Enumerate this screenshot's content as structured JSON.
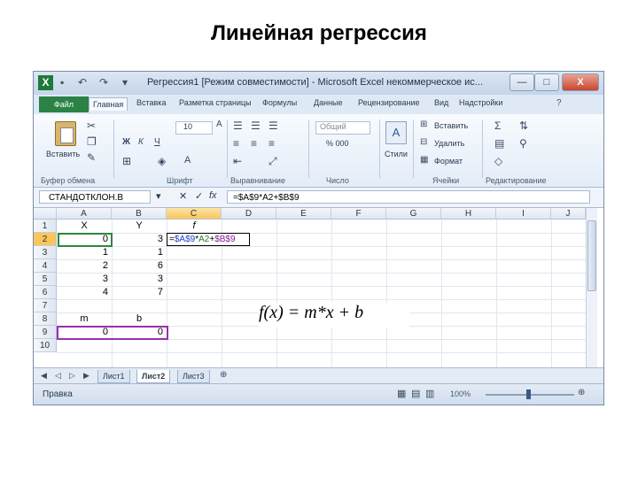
{
  "slide_title": "Линейная регрессия",
  "titlebar": {
    "app_icon": "X",
    "title": "Регрессия1 [Режим совместимости] - Microsoft Excel некоммерческое ис...",
    "min": "—",
    "max": "□",
    "close": "X"
  },
  "tabs": [
    "Файл",
    "Главная",
    "Вставка",
    "Разметка страницы",
    "Формулы",
    "Данные",
    "Рецензирование",
    "Вид",
    "Надстройки"
  ],
  "ribbon": {
    "paste": "Вставить",
    "font_size": "10",
    "bold": "Ж",
    "italic": "К",
    "underline": "Ч",
    "number_format": "Общий",
    "percent": "% 000",
    "styles": "Стили",
    "insert": "Вставить",
    "delete": "Удалить",
    "format": "Формат",
    "groups": [
      "Буфер обмена",
      "Шрифт",
      "Выравнивание",
      "Число",
      "Ячейки",
      "Редактирование"
    ]
  },
  "formula_bar": {
    "namebox": "СТАНДОТКЛОН.В",
    "cancel": "✕",
    "enter": "✓",
    "fx": "fx",
    "formula": "=$A$9*A2+$B$9"
  },
  "columns": [
    "A",
    "B",
    "C",
    "D",
    "E",
    "F",
    "G",
    "H",
    "I",
    "J"
  ],
  "rows": [
    "1",
    "2",
    "3",
    "4",
    "5",
    "6",
    "7",
    "8",
    "9",
    "10"
  ],
  "cells": {
    "A1": "X",
    "B1": "Y",
    "C1": "f",
    "A2": "0",
    "B2": "3",
    "A3": "1",
    "B3": "1",
    "A4": "2",
    "B4": "6",
    "A5": "3",
    "B5": "3",
    "A6": "4",
    "B6": "7",
    "A8": "m",
    "B8": "b",
    "A9": "0",
    "B9": "0"
  },
  "edit_cell": {
    "prefix": "=",
    "ref1": "$A$9",
    "mid1": "*",
    "ref2": "A2",
    "mid2": "+",
    "ref3": "$B$9"
  },
  "equation": "f(x) = m*x + b",
  "sheets": [
    "Лист1",
    "Лист2",
    "Лист3"
  ],
  "status": {
    "mode": "Правка",
    "zoom": "100%"
  }
}
